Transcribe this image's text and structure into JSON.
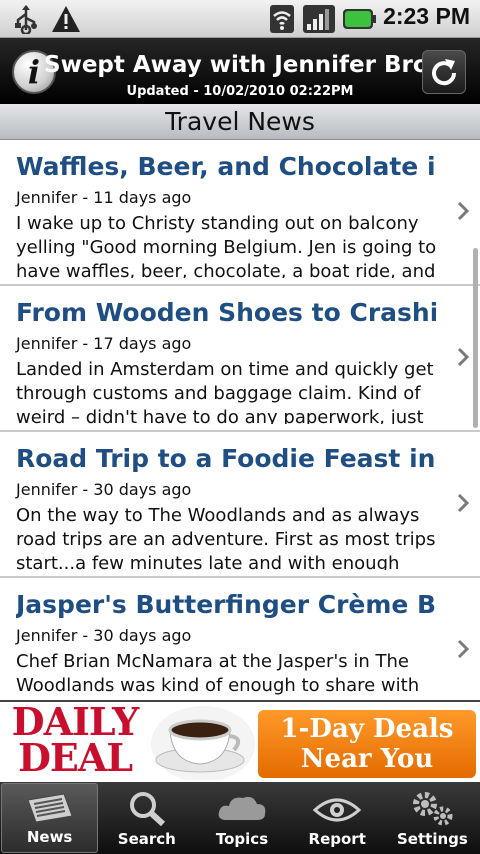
{
  "status_bar": {
    "time": "2:23 PM",
    "icons": [
      "usb-icon",
      "warning-icon",
      "wifi-icon",
      "signal-icon",
      "battery-icon"
    ]
  },
  "header": {
    "title": "Swept Away with Jennifer Broome",
    "updated": "Updated - 10/02/2010 02:22PM",
    "info_icon": "info-icon",
    "refresh_icon": "refresh-icon"
  },
  "section": {
    "title": "Travel News"
  },
  "news": [
    {
      "title": "Waffles, Beer, and Chocolate i...",
      "meta": "Jennifer - 11 days ago",
      "excerpt": "I wake up to Christy standing out on balcony yelling \"Good morning Belgium. Jen is going to have waffles, beer, chocolate, a boat ride, and"
    },
    {
      "title": "From Wooden Shoes to Crashin...",
      "meta": "Jennifer - 17 days ago",
      "excerpt": "Landed in Amsterdam on time and quickly get through customs and baggage claim. Kind of weird – didn't have to do any paperwork, just"
    },
    {
      "title": "Road Trip to a Foodie Feast in ...",
      "meta": "Jennifer - 30 days ago",
      "excerpt": "On the way to The Woodlands and as always road trips are an adventure. First as most trips start...a few minutes late and with enough"
    },
    {
      "title": "Jasper's Butterfinger Crème Br...",
      "meta": "Jennifer - 30 days ago",
      "excerpt": "Chef Brian McNamara at the Jasper's in The Woodlands was kind of enough to share with"
    }
  ],
  "ad": {
    "brand_line1": "DAILY",
    "brand_line2": "DEAL",
    "offer_line1": "1-Day Deals",
    "offer_line2": "Near You"
  },
  "tabs": [
    {
      "label": "News",
      "icon": "newspaper-icon",
      "active": true
    },
    {
      "label": "Search",
      "icon": "magnifier-icon",
      "active": false
    },
    {
      "label": "Topics",
      "icon": "cloud-icon",
      "active": false
    },
    {
      "label": "Report",
      "icon": "eye-icon",
      "active": false
    },
    {
      "label": "Settings",
      "icon": "gears-icon",
      "active": false
    }
  ],
  "colors": {
    "title_blue": "#1f4e82",
    "ad_red": "#c8102e",
    "ad_orange": "#f07d10",
    "battery_green": "#3cc23c"
  }
}
